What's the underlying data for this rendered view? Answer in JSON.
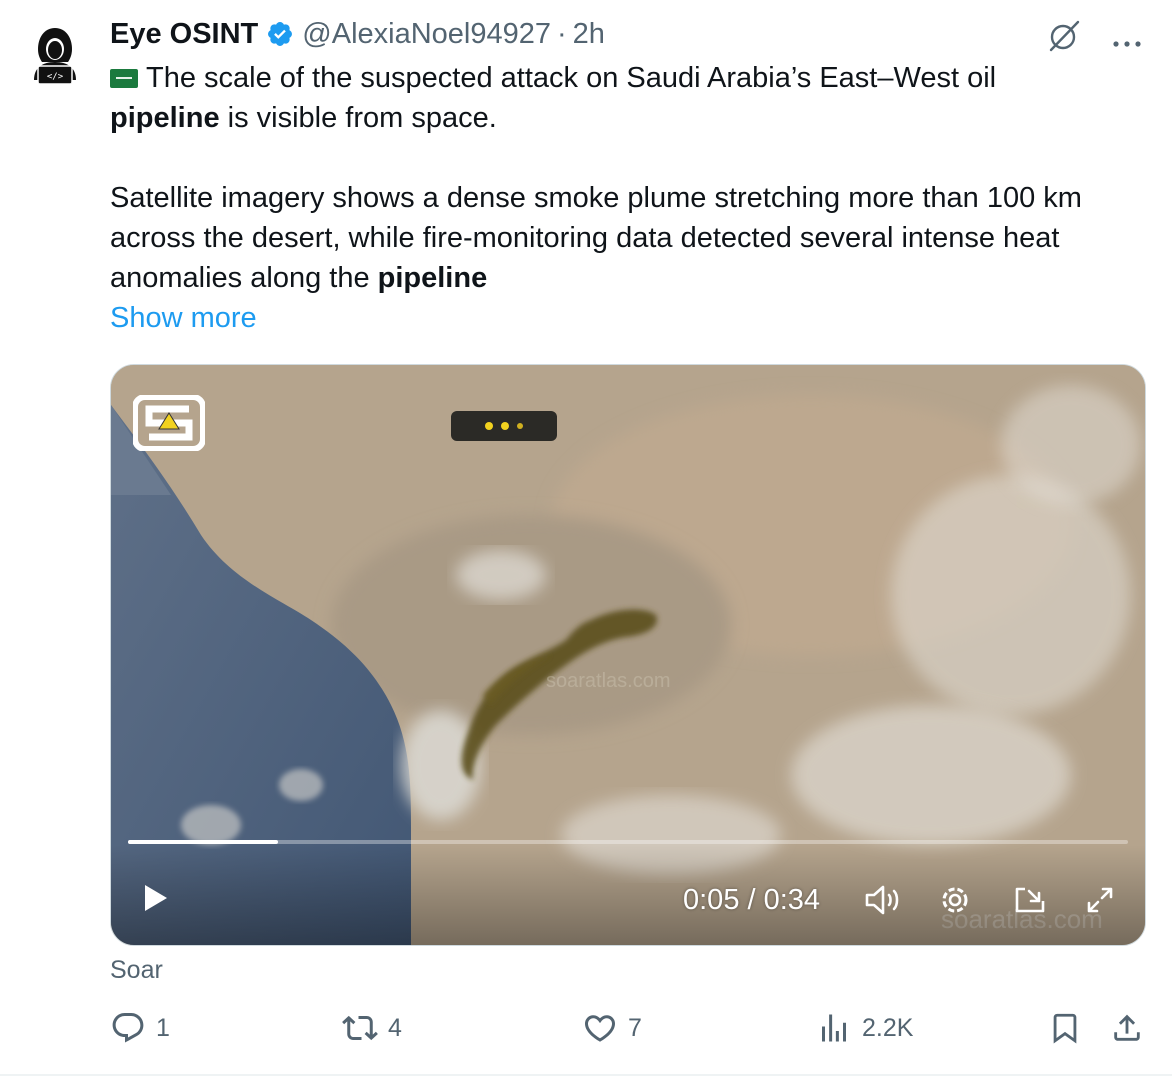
{
  "tweet": {
    "author_name": "Eye OSINT",
    "handle": "@AlexiaNoel94927",
    "separator": "·",
    "time": "2h",
    "paragraph1_part1": "The scale of the suspected attack on Saudi Arabia’s East–West oil",
    "paragraph1_bold": "pipeline",
    "paragraph1_part2": " is visible from space.",
    "paragraph2_part1": "Satellite imagery shows a dense smoke plume stretching more than 100 km across the desert, while fire-monitoring data detected several intense heat anomalies along the ",
    "paragraph2_bold": "pipeline",
    "show_more": "Show more",
    "flag_icon": "saudi-arabia-flag",
    "avatar_icon": "hooded-hacker-laptop"
  },
  "video": {
    "current_time": "0:05",
    "duration": "0:34",
    "time_display": "0:05 / 0:34",
    "progress_fraction": 0.15,
    "watermark": "soaratlas.com",
    "logo_letter": "S"
  },
  "media_source": "Soar",
  "actions": {
    "replies": "1",
    "reposts": "4",
    "likes": "7",
    "views": "2.2K"
  },
  "colors": {
    "accent": "#1d9bf0",
    "secondary_text": "#536471",
    "primary_text": "#0f1419",
    "flag_green": "#1b7a3e",
    "smoke_plume": "#5c4f1c"
  }
}
